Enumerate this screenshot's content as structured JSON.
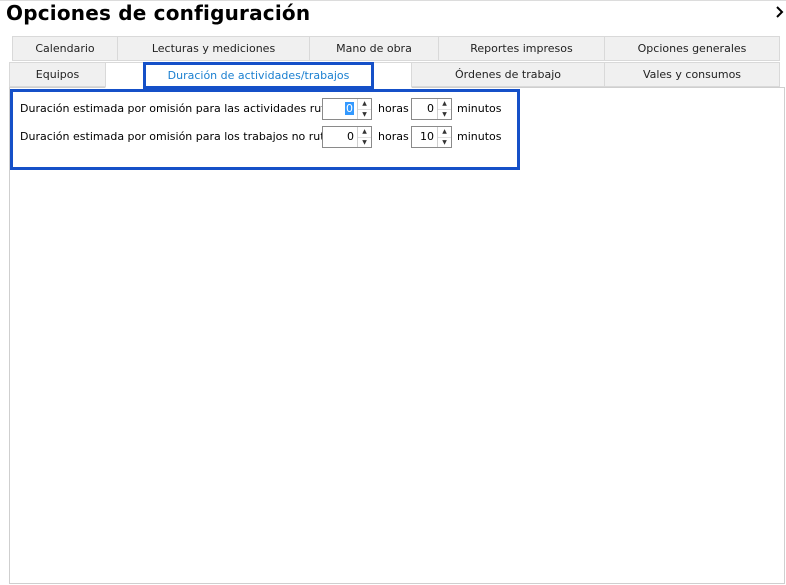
{
  "window": {
    "title": "Opciones de configuración",
    "nav_icon": "chevron-right-icon"
  },
  "tabs": {
    "row1": [
      "Calendario",
      "Lecturas y mediciones",
      "Mano de obra",
      "Reportes impresos",
      "Opciones generales"
    ],
    "row2": [
      "Equipos",
      "Duración de actividades/trabajos",
      "Órdenes de trabajo",
      "Vales y consumos"
    ],
    "selected": "Duración de actividades/trabajos"
  },
  "settings": {
    "rutinarias": {
      "label": "Duración estimada por omisión para las actividades rutinarias:",
      "hours": "0",
      "hours_unit": "horas",
      "minutes": "0",
      "minutes_unit": "minutos"
    },
    "no_rutinarios": {
      "label": "Duración estimada por omisión para los trabajos no rutinarios:",
      "hours": "0",
      "hours_unit": "horas",
      "minutes": "10",
      "minutes_unit": "minutos"
    }
  },
  "colors": {
    "highlight": "#1550c8",
    "selected_tab_text": "#1a7fd0",
    "selection": "#3399ff"
  }
}
